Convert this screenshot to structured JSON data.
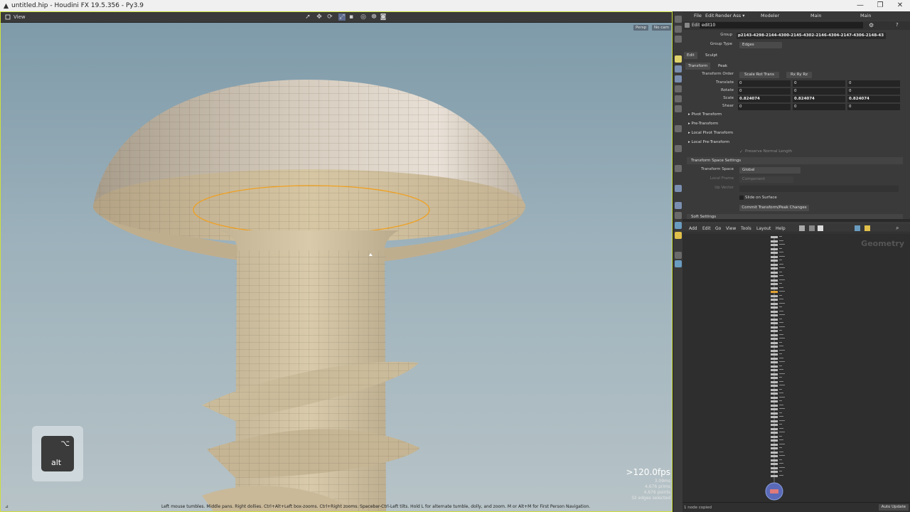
{
  "window": {
    "title": "untitled.hip - Houdini FX 19.5.356 - Py3.9",
    "controls": [
      "—",
      "❐",
      "✕"
    ]
  },
  "viewport": {
    "view_label": "View",
    "camera_chips": [
      "Persp",
      "No cam"
    ],
    "fps": ">120.0fps",
    "stats": [
      "3.09ms",
      "4,676  prims",
      "4,676 points",
      "32 edges selected"
    ],
    "hint": "Left mouse tumbles. Middle pans. Right dollies. Ctrl+Alt+Left box-zooms. Ctrl+Right zooms. Spacebar-Ctrl-Left tilts. Hold L for alternate tumble, dolly, and zoom.     M or Alt+M for First Person Navigation.",
    "corner_label": "⊿",
    "key_overlay": {
      "symbol": "⌥",
      "label": "alt"
    },
    "colors": {
      "highlight": "#f0a020",
      "model": "#c9bba0"
    }
  },
  "menubar": {
    "items": [
      "File",
      "Edit",
      "Render",
      "Ass ▾"
    ],
    "desktop": "Modeler",
    "pane": "Main",
    "pane2": "Main"
  },
  "parms": {
    "node_path": "edit10",
    "node_type": "Edit",
    "group_label": "Group",
    "group_value": "p2143-4298-2144-4300-2145-4302-2146-4304-2147-4306-2148-43",
    "group_type_label": "Group Type",
    "group_type_value": "Edges",
    "tabs": [
      "Edit",
      "Sculpt"
    ],
    "subtabs": [
      "Transform",
      "Peak"
    ],
    "transform_order_label": "Transform Order",
    "transform_order_value": "Scale Rot Trans",
    "rotate_order_value": "Rx Ry Rz",
    "translate_label": "Translate",
    "translate": [
      "0",
      "0",
      "0"
    ],
    "rotate_label": "Rotate",
    "rotate": [
      "0",
      "0",
      "0"
    ],
    "scale_label": "Scale",
    "scale": [
      "0.824074",
      "0.824074",
      "0.824074"
    ],
    "shear_label": "Shear",
    "shear": [
      "0",
      "0",
      "0"
    ],
    "folders": [
      "Pivot Transform",
      "Pre-Transform",
      "Local Pivot Transform",
      "Local Pre-Transform"
    ],
    "preserve_normal": "Preserve Normal Length",
    "transform_space_settings": "Transform Space Settings",
    "transform_space_label": "Transform Space",
    "transform_space_value": "Global",
    "local_frame_label": "Local Frame",
    "local_frame_value": "Component",
    "up_vector_label": "Up Vector",
    "slide_on_surface": "Slide on Surface",
    "commit_button": "Commit Transform/Peak Changes",
    "soft_settings": "Soft Settings"
  },
  "network": {
    "menu": [
      "Add",
      "Edit",
      "Go",
      "View",
      "Tools",
      "Layout",
      "Help"
    ],
    "context_label": "Geometry",
    "status": "1 node copied",
    "auto_update": "Auto Update"
  }
}
